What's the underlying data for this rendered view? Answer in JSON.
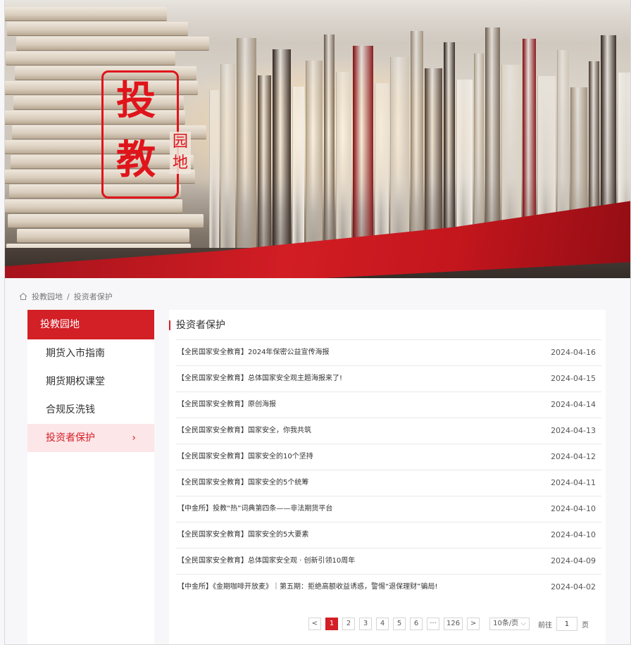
{
  "banner": {
    "logo_big_1": "投",
    "logo_big_2": "教",
    "logo_small_1": "园",
    "logo_small_2": "地"
  },
  "breadcrumb": {
    "home": "投教园地",
    "separator": "/",
    "current": "投资者保护"
  },
  "sidebar": {
    "header": "投教园地",
    "items": [
      {
        "label": "期货入市指南"
      },
      {
        "label": "期货期权课堂"
      },
      {
        "label": "合规反洗钱"
      },
      {
        "label": "投资者保护",
        "active": true,
        "chevron": "›"
      }
    ]
  },
  "main": {
    "title": "投资者保护",
    "articles": [
      {
        "title": "【全民国家安全教育】2024年保密公益宣传海报",
        "date": "2024-04-16"
      },
      {
        "title": "【全民国家安全教育】总体国家安全观主题海报来了!",
        "date": "2024-04-15"
      },
      {
        "title": "【全民国家安全教育】原创海报",
        "date": "2024-04-14"
      },
      {
        "title": "【全民国家安全教育】国家安全，你我共筑",
        "date": "2024-04-13"
      },
      {
        "title": "【全民国家安全教育】国家安全的10个坚持",
        "date": "2024-04-12"
      },
      {
        "title": "【全民国家安全教育】国家安全的5个统筹",
        "date": "2024-04-11"
      },
      {
        "title": "【中金所】投教“热”词典第四条——非法期货平台",
        "date": "2024-04-10"
      },
      {
        "title": "【全民国家安全教育】国家安全的5大要素",
        "date": "2024-04-10"
      },
      {
        "title": "【全民国家安全教育】总体国家安全观 · 创新引领10周年",
        "date": "2024-04-09"
      },
      {
        "title": "【中金所】《金期咖啡开放麦》｜第五期：拒绝高额收益诱惑，警惕“退保理财”骗局!",
        "date": "2024-04-02"
      }
    ]
  },
  "pagination": {
    "prev": "<",
    "pages": [
      "1",
      "2",
      "3",
      "4",
      "5",
      "6"
    ],
    "ellipsis": "···",
    "last": "126",
    "next": ">",
    "page_size": "10条/页",
    "goto_label": "前往",
    "goto_value": "1",
    "goto_suffix": "页"
  },
  "colors": {
    "accent": "#d31f26",
    "active_bg": "#fde6e8"
  }
}
